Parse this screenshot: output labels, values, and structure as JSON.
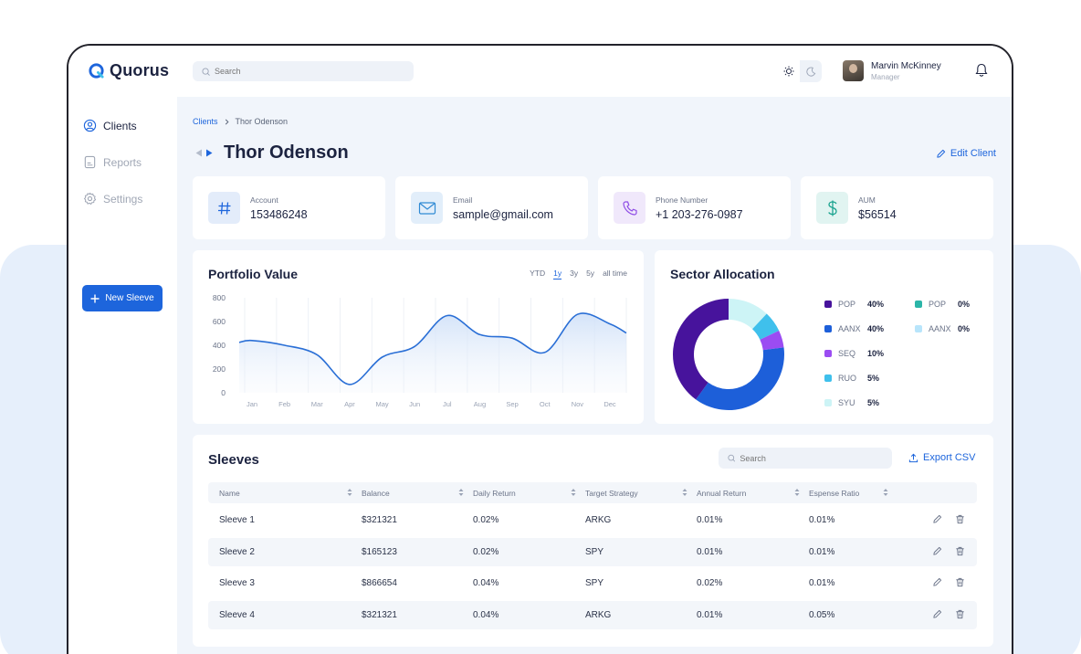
{
  "brand": {
    "name": "Quorus",
    "accent": "#1d65dc"
  },
  "topbar": {
    "search_placeholder": "Search",
    "user_name": "Marvin McKinney",
    "user_role": "Manager"
  },
  "sidebar": {
    "items": [
      {
        "label": "Clients",
        "icon": "user-circle-icon",
        "active": true
      },
      {
        "label": "Reports",
        "icon": "document-icon",
        "active": false
      },
      {
        "label": "Settings",
        "icon": "gear-icon",
        "active": false
      }
    ],
    "new_button": "New Sleeve"
  },
  "breadcrumb": {
    "parent": "Clients",
    "current": "Thor Odenson"
  },
  "page": {
    "title": "Thor Odenson",
    "edit_label": "Edit Client"
  },
  "info_cards": [
    {
      "label": "Account",
      "value": "153486248",
      "icon": "hash-icon"
    },
    {
      "label": "Email",
      "value": "sample@gmail.com",
      "icon": "mail-icon"
    },
    {
      "label": "Phone Number",
      "value": "+1 203-276-0987",
      "icon": "phone-icon"
    },
    {
      "label": "AUM",
      "value": "$56514",
      "icon": "dollar-icon"
    }
  ],
  "portfolio": {
    "title": "Portfolio Value",
    "ranges": [
      "YTD",
      "1y",
      "3y",
      "5y",
      "all time"
    ],
    "selected_range": "1y"
  },
  "chart_data": [
    {
      "type": "area",
      "title": "Portfolio Value",
      "x": [
        "Jan",
        "Feb",
        "Mar",
        "Apr",
        "May",
        "Jun",
        "Jul",
        "Aug",
        "Sep",
        "Oct",
        "Nov",
        "Dec"
      ],
      "series": [
        {
          "values": [
            440,
            400,
            320,
            70,
            300,
            390,
            650,
            490,
            460,
            340,
            660,
            580
          ]
        }
      ],
      "y_ticks": [
        0,
        200,
        400,
        600,
        800
      ],
      "ylim": [
        0,
        800
      ],
      "grid": "vertical"
    },
    {
      "type": "pie",
      "title": "Sector Allocation",
      "donut": true,
      "legend": [
        {
          "name": "POP",
          "label": "40%",
          "color": "#47139c"
        },
        {
          "name": "AANX",
          "label": "40%",
          "color": "#1d5fd9"
        },
        {
          "name": "SEQ",
          "label": "10%",
          "color": "#9b4cf2"
        },
        {
          "name": "RUO",
          "label": "5%",
          "color": "#3fc0ec"
        },
        {
          "name": "SYU",
          "label": "5%",
          "color": "#cdf4f6"
        },
        {
          "name": "POP",
          "label": "0%",
          "color": "#2bb5a8"
        },
        {
          "name": "AANX",
          "label": "0%",
          "color": "#b8e5fb"
        }
      ],
      "slices": [
        {
          "color": "#47139c",
          "value": 40
        },
        {
          "color": "#1d5fd9",
          "value": 37
        },
        {
          "color": "#9b4cf2",
          "value": 5
        },
        {
          "color": "#3fc0ec",
          "value": 6
        },
        {
          "color": "#cdf4f6",
          "value": 12
        }
      ]
    }
  ],
  "sleeves": {
    "title": "Sleeves",
    "search_placeholder": "Search",
    "export_label": "Export CSV",
    "columns": [
      "Name",
      "Balance",
      "Daily Return",
      "Target Strategy",
      "Annual Return",
      "Espense Ratio"
    ],
    "rows": [
      [
        "Sleeve 1",
        "$321321",
        "0.02%",
        "ARKG",
        "0.01%",
        "0.01%"
      ],
      [
        "Sleeve 2",
        "$165123",
        "0.02%",
        "SPY",
        "0.01%",
        "0.01%"
      ],
      [
        "Sleeve 3",
        "$866654",
        "0.04%",
        "SPY",
        "0.02%",
        "0.01%"
      ],
      [
        "Sleeve 4",
        "$321321",
        "0.04%",
        "ARKG",
        "0.01%",
        "0.05%"
      ]
    ]
  }
}
